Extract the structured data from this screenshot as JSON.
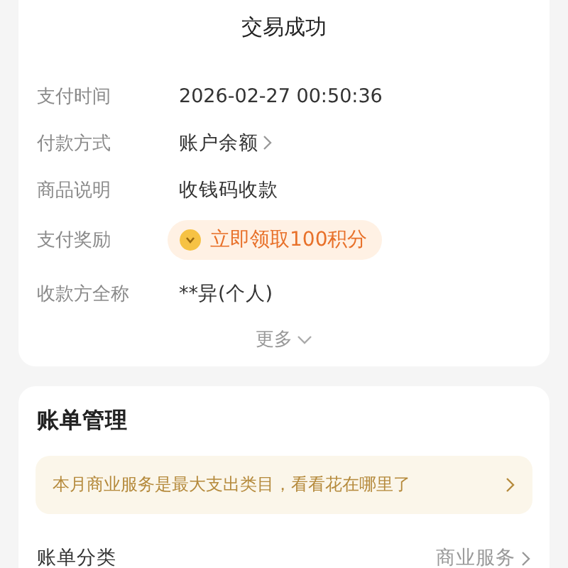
{
  "status": "交易成功",
  "details": [
    {
      "kind": "text",
      "label": "支付时间",
      "value": "2026-02-27 00:50:36"
    },
    {
      "kind": "link",
      "label": "付款方式",
      "value": "账户余额"
    },
    {
      "kind": "text",
      "label": "商品说明",
      "value": "收钱码收款"
    },
    {
      "kind": "reward",
      "label": "支付奖励",
      "value": "立即领取100积分"
    },
    {
      "kind": "text",
      "label": "收款方全称",
      "value": "**异(个人)"
    }
  ],
  "more": "更多",
  "bill_management": {
    "title": "账单管理",
    "tip": "本月商业服务是最大支出类目，看看花在哪里了",
    "rows": [
      {
        "label": "账单分类",
        "value": "商业服务"
      }
    ]
  }
}
